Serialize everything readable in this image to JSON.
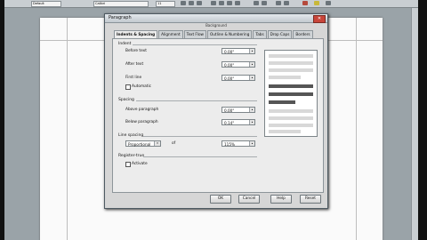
{
  "toolbar": {
    "font_style": "Default",
    "font_name": "Calibri",
    "font_size": "11"
  },
  "dialog": {
    "title": "Paragraph",
    "subtitle": "Background",
    "tabs": [
      "Indents & Spacing",
      "Alignment",
      "Text Flow",
      "Outline & Numbering",
      "Tabs",
      "Drop Caps",
      "Borders"
    ],
    "indent": {
      "section": "Indent",
      "before_text": {
        "label": "Before text",
        "value": "0.00\""
      },
      "after_text": {
        "label": "After text",
        "value": "0.00\""
      },
      "first_line": {
        "label": "First line",
        "value": "0.00\""
      },
      "automatic": "Automatic"
    },
    "spacing": {
      "section": "Spacing",
      "above": {
        "label": "Above paragraph",
        "value": "0.00\""
      },
      "below": {
        "label": "Below paragraph",
        "value": "0.14\""
      }
    },
    "line_spacing": {
      "section": "Line spacing",
      "mode": "Proportional",
      "of_label": "of",
      "value": "115%"
    },
    "register": {
      "section": "Register-true",
      "activate": "Activate"
    },
    "buttons": {
      "ok": "OK",
      "cancel": "Cancel",
      "help": "Help",
      "reset": "Reset"
    }
  }
}
